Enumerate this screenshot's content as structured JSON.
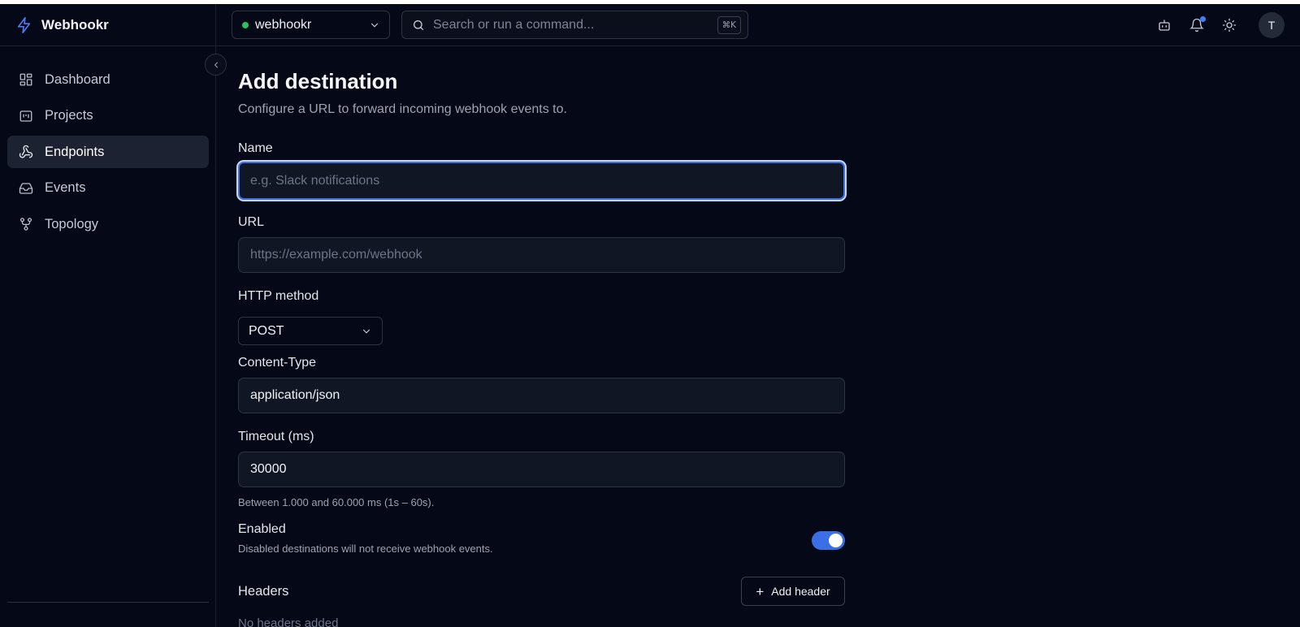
{
  "app": {
    "brand_name": "Webhookr",
    "accent": "#3b6fe6"
  },
  "sidebar": {
    "items": [
      {
        "label": "Dashboard",
        "icon": "dashboard-grid-icon"
      },
      {
        "label": "Projects",
        "icon": "projects-kanban-icon"
      },
      {
        "label": "Endpoints",
        "icon": "webhook-icon",
        "active": true
      },
      {
        "label": "Events",
        "icon": "inbox-icon"
      },
      {
        "label": "Topology",
        "icon": "topology-branch-icon"
      }
    ]
  },
  "topbar": {
    "project_name": "webhookr",
    "project_status_color": "#22c55e",
    "search_placeholder": "Search or run a command...",
    "search_shortcut": "⌘K",
    "avatar_initial": "T"
  },
  "page": {
    "title": "Add destination",
    "subtitle": "Configure a URL to forward incoming webhook events to."
  },
  "form": {
    "name_label": "Name",
    "name_placeholder": "e.g. Slack notifications",
    "url_label": "URL",
    "url_placeholder": "https://example.com/webhook",
    "method_label": "HTTP method",
    "method_value": "POST",
    "content_type_label": "Content-Type",
    "content_type_value": "application/json",
    "timeout_label": "Timeout (ms)",
    "timeout_value": "30000",
    "timeout_hint": "Between 1.000 and 60.000 ms (1s – 60s).",
    "enabled_label": "Enabled",
    "enabled_hint": "Disabled destinations will not receive webhook events.",
    "enabled": true,
    "headers_label": "Headers",
    "add_header_label": "Add header",
    "headers_empty": "No headers added"
  }
}
